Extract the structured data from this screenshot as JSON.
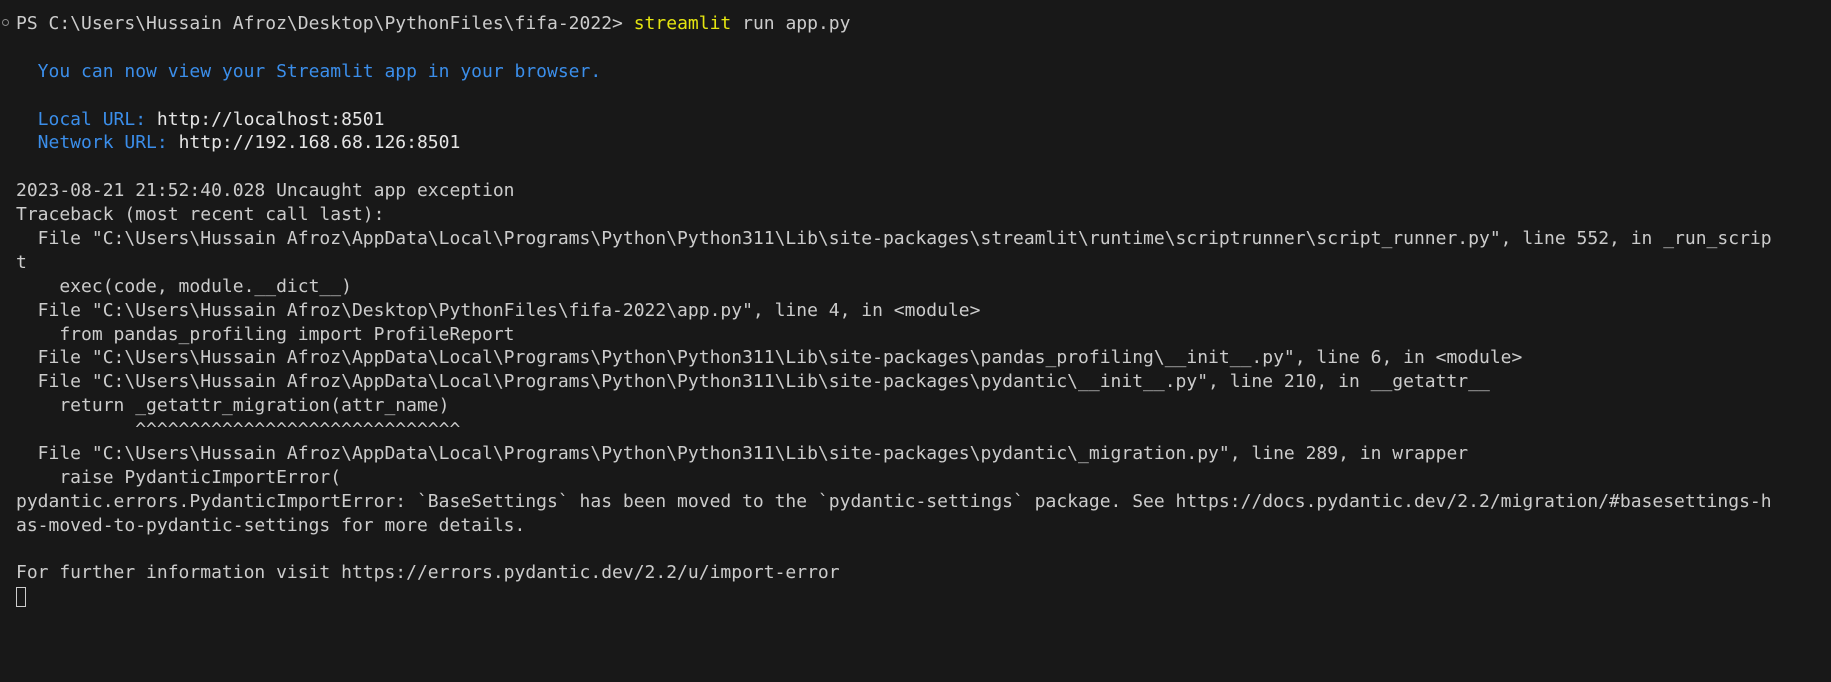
{
  "prompt": {
    "path": "PS C:\\Users\\Hussain Afroz\\Desktop\\PythonFiles\\fifa-2022> ",
    "command": "streamlit",
    "args": " run app.py"
  },
  "streamlit": {
    "view_message": "  You can now view your Streamlit app in your browser.",
    "local_label": "  Local URL: ",
    "local_url": "http://localhost:8501",
    "network_label": "  Network URL: ",
    "network_url": "http://192.168.68.126:8501"
  },
  "traceback": {
    "exception_line": "2023-08-21 21:52:40.028 Uncaught app exception",
    "header": "Traceback (most recent call last):",
    "lines": [
      "  File \"C:\\Users\\Hussain Afroz\\AppData\\Local\\Programs\\Python\\Python311\\Lib\\site-packages\\streamlit\\runtime\\scriptrunner\\script_runner.py\", line 552, in _run_scrip",
      "t",
      "    exec(code, module.__dict__)",
      "  File \"C:\\Users\\Hussain Afroz\\Desktop\\PythonFiles\\fifa-2022\\app.py\", line 4, in <module>",
      "    from pandas_profiling import ProfileReport",
      "  File \"C:\\Users\\Hussain Afroz\\AppData\\Local\\Programs\\Python\\Python311\\Lib\\site-packages\\pandas_profiling\\__init__.py\", line 6, in <module>",
      "  File \"C:\\Users\\Hussain Afroz\\AppData\\Local\\Programs\\Python\\Python311\\Lib\\site-packages\\pydantic\\__init__.py\", line 210, in __getattr__",
      "    return _getattr_migration(attr_name)",
      "           ^^^^^^^^^^^^^^^^^^^^^^^^^^^^^^",
      "  File \"C:\\Users\\Hussain Afroz\\AppData\\Local\\Programs\\Python\\Python311\\Lib\\site-packages\\pydantic\\_migration.py\", line 289, in wrapper",
      "    raise PydanticImportError(",
      "pydantic.errors.PydanticImportError: `BaseSettings` has been moved to the `pydantic-settings` package. See https://docs.pydantic.dev/2.2/migration/#basesettings-h",
      "as-moved-to-pydantic-settings for more details."
    ]
  },
  "footer": {
    "info": "For further information visit https://errors.pydantic.dev/2.2/u/import-error"
  },
  "colors": {
    "background": "#181818",
    "foreground": "#cccccc",
    "command": "#e5e510",
    "info_blue": "#3b8eea"
  }
}
